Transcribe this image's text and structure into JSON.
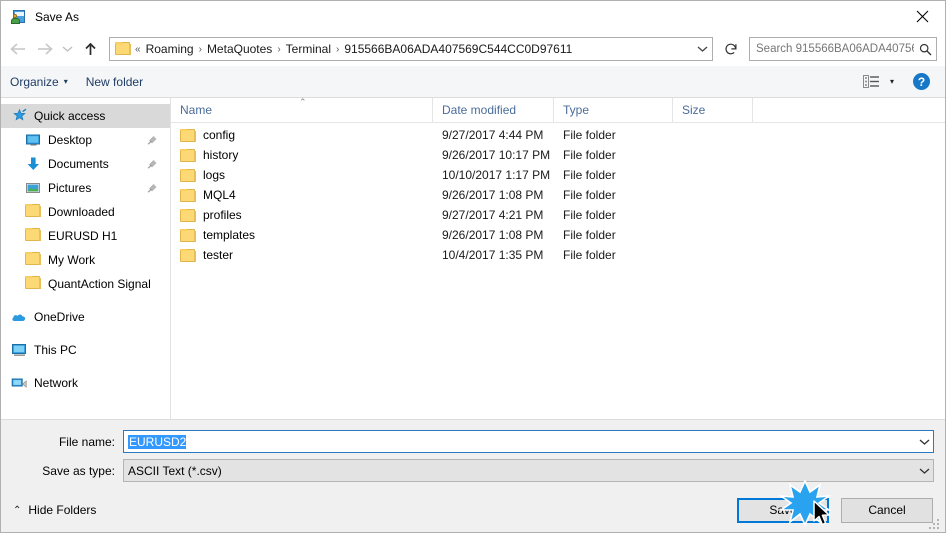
{
  "window": {
    "title": "Save As",
    "icon": "save-as-icon",
    "close_label": "✕"
  },
  "nav": {
    "back": "←",
    "forward": "→",
    "recent": "⌄",
    "up": "↑",
    "refresh": "↻",
    "dropdown": "⌄"
  },
  "address": {
    "folder_icon": "folder-icon",
    "prefix": "«",
    "crumbs": [
      "Roaming",
      "MetaQuotes",
      "Terminal",
      "915566BA06ADA407569C544CC0D97611"
    ],
    "separator": "›"
  },
  "search": {
    "placeholder": "Search 915566BA06ADA40756...",
    "icon": "search-icon"
  },
  "toolbar": {
    "organize_label": "Organize",
    "organize_caret": "▾",
    "new_folder_label": "New folder",
    "view_icon": "view-layout-icon",
    "view_caret": "▾",
    "help_label": "?"
  },
  "sidebar": {
    "items": [
      {
        "label": "Quick access",
        "icon": "star-pin-icon",
        "selected": true,
        "pinned": false,
        "indent": false,
        "group": false
      },
      {
        "label": "Desktop",
        "icon": "monitor-icon",
        "selected": false,
        "pinned": true,
        "indent": true,
        "group": false
      },
      {
        "label": "Documents",
        "icon": "download-arrow-icon",
        "selected": false,
        "pinned": true,
        "indent": true,
        "group": false
      },
      {
        "label": "Pictures",
        "icon": "picture-icon",
        "selected": false,
        "pinned": true,
        "indent": true,
        "group": false
      },
      {
        "label": "Downloaded",
        "icon": "folder-icon",
        "selected": false,
        "pinned": false,
        "indent": true,
        "group": false
      },
      {
        "label": "EURUSD H1",
        "icon": "folder-icon",
        "selected": false,
        "pinned": false,
        "indent": true,
        "group": false
      },
      {
        "label": "My Work",
        "icon": "folder-icon",
        "selected": false,
        "pinned": false,
        "indent": true,
        "group": false
      },
      {
        "label": "QuantAction Signal",
        "icon": "folder-icon",
        "selected": false,
        "pinned": false,
        "indent": true,
        "group": false
      },
      {
        "label": "OneDrive",
        "icon": "cloud-icon",
        "selected": false,
        "pinned": false,
        "indent": false,
        "group": true
      },
      {
        "label": "This PC",
        "icon": "computer-icon",
        "selected": false,
        "pinned": false,
        "indent": false,
        "group": true
      },
      {
        "label": "Network",
        "icon": "network-icon",
        "selected": false,
        "pinned": false,
        "indent": false,
        "group": true
      }
    ],
    "pin_icon": "pin-icon"
  },
  "filelist": {
    "columns": [
      "Name",
      "Date modified",
      "Type",
      "Size"
    ],
    "sort_caret": "⌃",
    "rows": [
      {
        "name": "config",
        "date": "9/27/2017 4:44 PM",
        "type": "File folder",
        "size": ""
      },
      {
        "name": "history",
        "date": "9/26/2017 10:17 PM",
        "type": "File folder",
        "size": ""
      },
      {
        "name": "logs",
        "date": "10/10/2017 1:17 PM",
        "type": "File folder",
        "size": ""
      },
      {
        "name": "MQL4",
        "date": "9/26/2017 1:08 PM",
        "type": "File folder",
        "size": ""
      },
      {
        "name": "profiles",
        "date": "9/27/2017 4:21 PM",
        "type": "File folder",
        "size": ""
      },
      {
        "name": "templates",
        "date": "9/26/2017 1:08 PM",
        "type": "File folder",
        "size": ""
      },
      {
        "name": "tester",
        "date": "10/4/2017 1:35 PM",
        "type": "File folder",
        "size": ""
      }
    ]
  },
  "form": {
    "filename_label": "File name:",
    "filename_value": "EURUSD2",
    "filetype_label": "Save as type:",
    "filetype_value": "ASCII Text (*.csv)",
    "combo_arrow": "⌄"
  },
  "footer": {
    "hide_folders_label": "Hide Folders",
    "hide_folders_caret": "⌃",
    "save_label": "Save",
    "cancel_label": "Cancel"
  },
  "colors": {
    "accent": "#0078d7",
    "selection": "#3399ff",
    "link": "#1f3c65",
    "column_header": "#4a6c9b",
    "folder": "#fcd975"
  }
}
